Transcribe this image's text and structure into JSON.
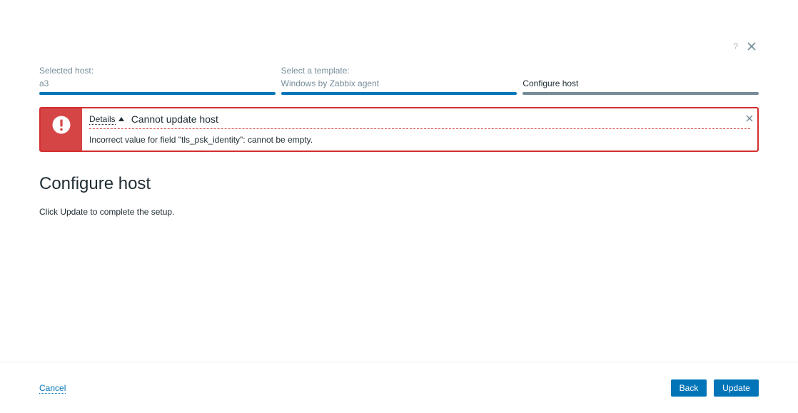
{
  "header": {
    "help_label": "?"
  },
  "steps": [
    {
      "label": "Selected host:",
      "value": "a3"
    },
    {
      "label": "Select a template:",
      "value": "Windows by Zabbix agent"
    },
    {
      "label": "",
      "value": "Configure host"
    }
  ],
  "message": {
    "details_label": "Details",
    "title": "Cannot update host",
    "detail": "Incorrect value for field \"tls_psk_identity\": cannot be empty."
  },
  "main": {
    "title": "Configure host",
    "description": "Click Update to complete the setup."
  },
  "footer": {
    "cancel_label": "Cancel",
    "back_label": "Back",
    "update_label": "Update"
  },
  "colors": {
    "accent": "#0275b8",
    "error": "#d64545",
    "step_inactive": "#768d99"
  }
}
